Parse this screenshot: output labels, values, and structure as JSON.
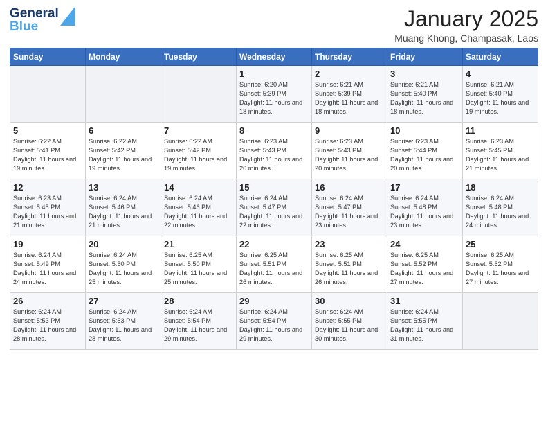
{
  "header": {
    "logo_line1": "General",
    "logo_line2": "Blue",
    "month_title": "January 2025",
    "location": "Muang Khong, Champasak, Laos"
  },
  "weekdays": [
    "Sunday",
    "Monday",
    "Tuesday",
    "Wednesday",
    "Thursday",
    "Friday",
    "Saturday"
  ],
  "weeks": [
    [
      {
        "day": "",
        "sunrise": "",
        "sunset": "",
        "daylight": "",
        "empty": true
      },
      {
        "day": "",
        "sunrise": "",
        "sunset": "",
        "daylight": "",
        "empty": true
      },
      {
        "day": "",
        "sunrise": "",
        "sunset": "",
        "daylight": "",
        "empty": true
      },
      {
        "day": "1",
        "sunrise": "Sunrise: 6:20 AM",
        "sunset": "Sunset: 5:39 PM",
        "daylight": "Daylight: 11 hours and 18 minutes.",
        "empty": false
      },
      {
        "day": "2",
        "sunrise": "Sunrise: 6:21 AM",
        "sunset": "Sunset: 5:39 PM",
        "daylight": "Daylight: 11 hours and 18 minutes.",
        "empty": false
      },
      {
        "day": "3",
        "sunrise": "Sunrise: 6:21 AM",
        "sunset": "Sunset: 5:40 PM",
        "daylight": "Daylight: 11 hours and 18 minutes.",
        "empty": false
      },
      {
        "day": "4",
        "sunrise": "Sunrise: 6:21 AM",
        "sunset": "Sunset: 5:40 PM",
        "daylight": "Daylight: 11 hours and 19 minutes.",
        "empty": false
      }
    ],
    [
      {
        "day": "5",
        "sunrise": "Sunrise: 6:22 AM",
        "sunset": "Sunset: 5:41 PM",
        "daylight": "Daylight: 11 hours and 19 minutes.",
        "empty": false
      },
      {
        "day": "6",
        "sunrise": "Sunrise: 6:22 AM",
        "sunset": "Sunset: 5:42 PM",
        "daylight": "Daylight: 11 hours and 19 minutes.",
        "empty": false
      },
      {
        "day": "7",
        "sunrise": "Sunrise: 6:22 AM",
        "sunset": "Sunset: 5:42 PM",
        "daylight": "Daylight: 11 hours and 19 minutes.",
        "empty": false
      },
      {
        "day": "8",
        "sunrise": "Sunrise: 6:23 AM",
        "sunset": "Sunset: 5:43 PM",
        "daylight": "Daylight: 11 hours and 20 minutes.",
        "empty": false
      },
      {
        "day": "9",
        "sunrise": "Sunrise: 6:23 AM",
        "sunset": "Sunset: 5:43 PM",
        "daylight": "Daylight: 11 hours and 20 minutes.",
        "empty": false
      },
      {
        "day": "10",
        "sunrise": "Sunrise: 6:23 AM",
        "sunset": "Sunset: 5:44 PM",
        "daylight": "Daylight: 11 hours and 20 minutes.",
        "empty": false
      },
      {
        "day": "11",
        "sunrise": "Sunrise: 6:23 AM",
        "sunset": "Sunset: 5:45 PM",
        "daylight": "Daylight: 11 hours and 21 minutes.",
        "empty": false
      }
    ],
    [
      {
        "day": "12",
        "sunrise": "Sunrise: 6:23 AM",
        "sunset": "Sunset: 5:45 PM",
        "daylight": "Daylight: 11 hours and 21 minutes.",
        "empty": false
      },
      {
        "day": "13",
        "sunrise": "Sunrise: 6:24 AM",
        "sunset": "Sunset: 5:46 PM",
        "daylight": "Daylight: 11 hours and 21 minutes.",
        "empty": false
      },
      {
        "day": "14",
        "sunrise": "Sunrise: 6:24 AM",
        "sunset": "Sunset: 5:46 PM",
        "daylight": "Daylight: 11 hours and 22 minutes.",
        "empty": false
      },
      {
        "day": "15",
        "sunrise": "Sunrise: 6:24 AM",
        "sunset": "Sunset: 5:47 PM",
        "daylight": "Daylight: 11 hours and 22 minutes.",
        "empty": false
      },
      {
        "day": "16",
        "sunrise": "Sunrise: 6:24 AM",
        "sunset": "Sunset: 5:47 PM",
        "daylight": "Daylight: 11 hours and 23 minutes.",
        "empty": false
      },
      {
        "day": "17",
        "sunrise": "Sunrise: 6:24 AM",
        "sunset": "Sunset: 5:48 PM",
        "daylight": "Daylight: 11 hours and 23 minutes.",
        "empty": false
      },
      {
        "day": "18",
        "sunrise": "Sunrise: 6:24 AM",
        "sunset": "Sunset: 5:48 PM",
        "daylight": "Daylight: 11 hours and 24 minutes.",
        "empty": false
      }
    ],
    [
      {
        "day": "19",
        "sunrise": "Sunrise: 6:24 AM",
        "sunset": "Sunset: 5:49 PM",
        "daylight": "Daylight: 11 hours and 24 minutes.",
        "empty": false
      },
      {
        "day": "20",
        "sunrise": "Sunrise: 6:24 AM",
        "sunset": "Sunset: 5:50 PM",
        "daylight": "Daylight: 11 hours and 25 minutes.",
        "empty": false
      },
      {
        "day": "21",
        "sunrise": "Sunrise: 6:25 AM",
        "sunset": "Sunset: 5:50 PM",
        "daylight": "Daylight: 11 hours and 25 minutes.",
        "empty": false
      },
      {
        "day": "22",
        "sunrise": "Sunrise: 6:25 AM",
        "sunset": "Sunset: 5:51 PM",
        "daylight": "Daylight: 11 hours and 26 minutes.",
        "empty": false
      },
      {
        "day": "23",
        "sunrise": "Sunrise: 6:25 AM",
        "sunset": "Sunset: 5:51 PM",
        "daylight": "Daylight: 11 hours and 26 minutes.",
        "empty": false
      },
      {
        "day": "24",
        "sunrise": "Sunrise: 6:25 AM",
        "sunset": "Sunset: 5:52 PM",
        "daylight": "Daylight: 11 hours and 27 minutes.",
        "empty": false
      },
      {
        "day": "25",
        "sunrise": "Sunrise: 6:25 AM",
        "sunset": "Sunset: 5:52 PM",
        "daylight": "Daylight: 11 hours and 27 minutes.",
        "empty": false
      }
    ],
    [
      {
        "day": "26",
        "sunrise": "Sunrise: 6:24 AM",
        "sunset": "Sunset: 5:53 PM",
        "daylight": "Daylight: 11 hours and 28 minutes.",
        "empty": false
      },
      {
        "day": "27",
        "sunrise": "Sunrise: 6:24 AM",
        "sunset": "Sunset: 5:53 PM",
        "daylight": "Daylight: 11 hours and 28 minutes.",
        "empty": false
      },
      {
        "day": "28",
        "sunrise": "Sunrise: 6:24 AM",
        "sunset": "Sunset: 5:54 PM",
        "daylight": "Daylight: 11 hours and 29 minutes.",
        "empty": false
      },
      {
        "day": "29",
        "sunrise": "Sunrise: 6:24 AM",
        "sunset": "Sunset: 5:54 PM",
        "daylight": "Daylight: 11 hours and 29 minutes.",
        "empty": false
      },
      {
        "day": "30",
        "sunrise": "Sunrise: 6:24 AM",
        "sunset": "Sunset: 5:55 PM",
        "daylight": "Daylight: 11 hours and 30 minutes.",
        "empty": false
      },
      {
        "day": "31",
        "sunrise": "Sunrise: 6:24 AM",
        "sunset": "Sunset: 5:55 PM",
        "daylight": "Daylight: 11 hours and 31 minutes.",
        "empty": false
      },
      {
        "day": "",
        "sunrise": "",
        "sunset": "",
        "daylight": "",
        "empty": true
      }
    ]
  ]
}
